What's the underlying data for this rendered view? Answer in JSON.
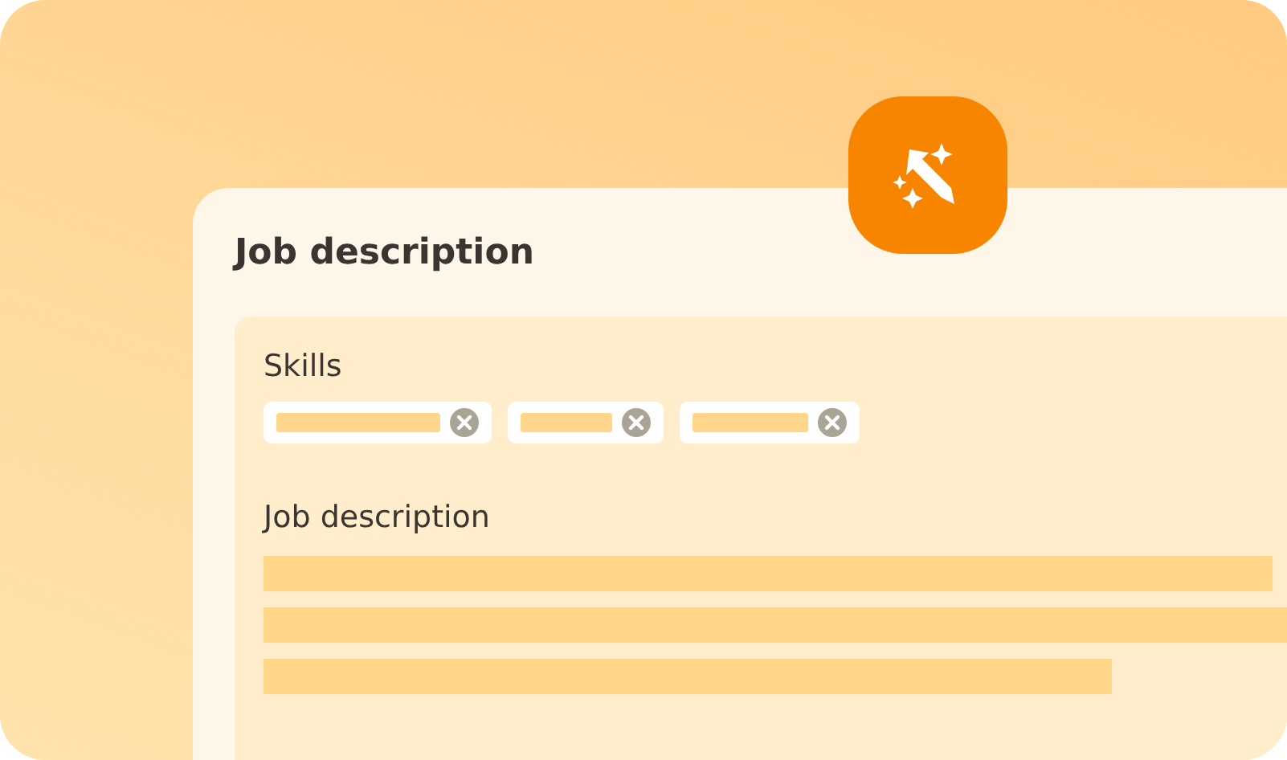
{
  "card": {
    "title": "Job description",
    "skills_label": "Skills",
    "description_label": "Job description"
  }
}
